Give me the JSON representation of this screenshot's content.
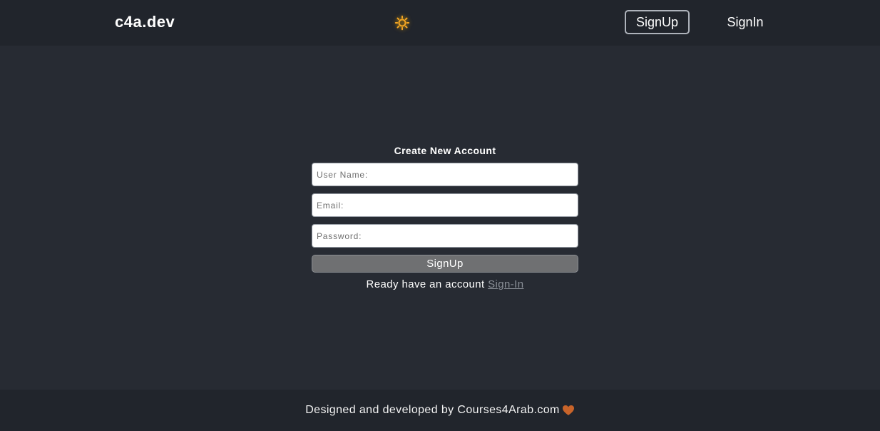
{
  "header": {
    "logo": "c4a.dev",
    "theme_icon": "sun-icon",
    "nav": {
      "signup_label": "SignUp",
      "signin_label": "SignIn"
    }
  },
  "form": {
    "title": "Create New Account",
    "fields": [
      {
        "placeholder": "User Name:",
        "value": ""
      },
      {
        "placeholder": "Email:",
        "value": ""
      },
      {
        "placeholder": "Password:",
        "value": ""
      }
    ],
    "submit_label": "SignUp",
    "already_text": "Ready have an account",
    "signin_link": "Sign-In"
  },
  "footer": {
    "text": "Designed and developed by Courses4Arab.com",
    "heart_icon": "heart-icon"
  },
  "colors": {
    "background": "#272b33",
    "header_footer": "#21252c",
    "accent_sun": "#f5a623",
    "heart": "#c8642a",
    "submit_bg": "#6f7072"
  }
}
